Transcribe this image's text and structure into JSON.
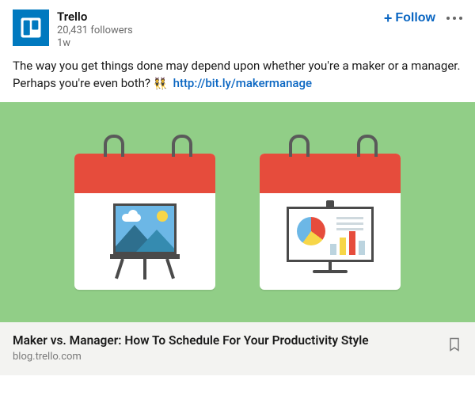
{
  "header": {
    "name": "Trello",
    "followers": "20,431 followers",
    "time": "1w",
    "follow_label": "Follow"
  },
  "post": {
    "text_before_link": "The way you get things done may depend upon whether you're a maker or a manager. Perhaps you're even both? ",
    "emoji": "👯",
    "link_text": "http://bit.ly/makermanage"
  },
  "link_preview": {
    "title": "Maker vs. Manager: How To Schedule For Your Productivity Style",
    "source": "blog.trello.com"
  },
  "colors": {
    "brand": "#0079bf",
    "accent": "#0a66c2",
    "hero_bg": "#91ce87"
  }
}
